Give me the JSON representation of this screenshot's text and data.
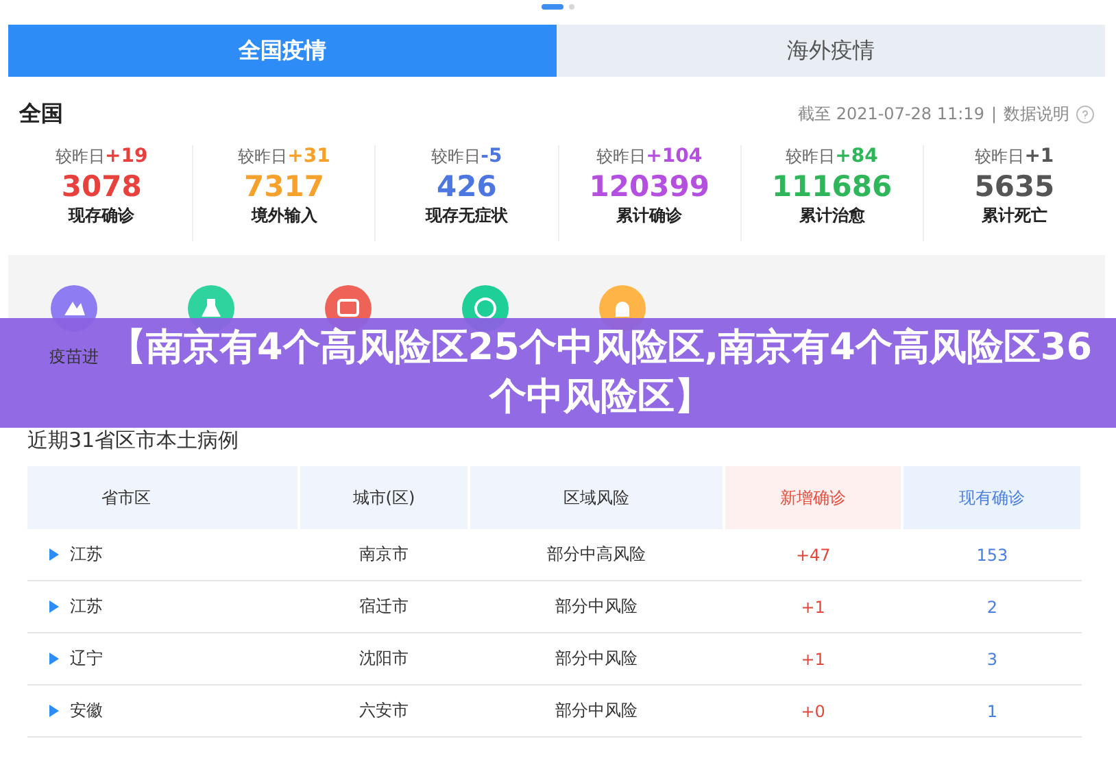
{
  "pager": [
    {
      "selected": true
    },
    {
      "selected": false
    }
  ],
  "tabs": [
    {
      "label": "全国疫情",
      "selected": true
    },
    {
      "label": "海外疫情",
      "selected": false
    }
  ],
  "summary": {
    "title": "全国",
    "updated": "截至 2021-07-28 11:19",
    "separator": "|",
    "info_link": "数据说明"
  },
  "stats": [
    {
      "delta_label": "较昨日",
      "delta": "+19",
      "value": "3078",
      "label": "现存确诊",
      "color": "#e8413d"
    },
    {
      "delta_label": "较昨日",
      "delta": "+31",
      "value": "7317",
      "label": "境外输入",
      "color": "#f5a12b"
    },
    {
      "delta_label": "较昨日",
      "delta": "-5",
      "value": "426",
      "label": "现存无症状",
      "color": "#4c76e0"
    },
    {
      "delta_label": "较昨日",
      "delta": "+104",
      "value": "120399",
      "label": "累计确诊",
      "color": "#b44fe0"
    },
    {
      "delta_label": "较昨日",
      "delta": "+84",
      "value": "111686",
      "label": "累计治愈",
      "color": "#2fb55a"
    },
    {
      "delta_label": "较昨日",
      "delta": "+1",
      "value": "5635",
      "label": "累计死亡",
      "color": "#555555"
    }
  ],
  "shortcuts": [
    {
      "label": "疫苗进",
      "color": "#8e7cf2"
    },
    {
      "color": "#2fd39e"
    },
    {
      "color": "#ef6257"
    },
    {
      "color": "#1fcf98"
    },
    {
      "color": "#ffb447"
    }
  ],
  "banner_title": "【南京有4个高风险区25个中风险区,南京有4个高风险区36个中风险区】",
  "section_title": "近期31省区市本土病例",
  "table": {
    "columns": [
      "省市区",
      "城市(区)",
      "区域风险",
      "新增确诊",
      "现有确诊"
    ],
    "rows": [
      {
        "cells": [
          "江苏",
          "南京市",
          "部分中高风险",
          "+47",
          "153"
        ],
        "expanded": false
      },
      {
        "cells": [
          "江苏",
          "宿迁市",
          "部分中风险",
          "+1",
          "2"
        ],
        "expanded": false
      },
      {
        "cells": [
          "辽宁",
          "沈阳市",
          "部分中风险",
          "+1",
          "3"
        ],
        "expanded": false
      },
      {
        "cells": [
          "安徽",
          "六安市",
          "部分中风险",
          "+0",
          "1"
        ],
        "expanded": false
      }
    ]
  }
}
